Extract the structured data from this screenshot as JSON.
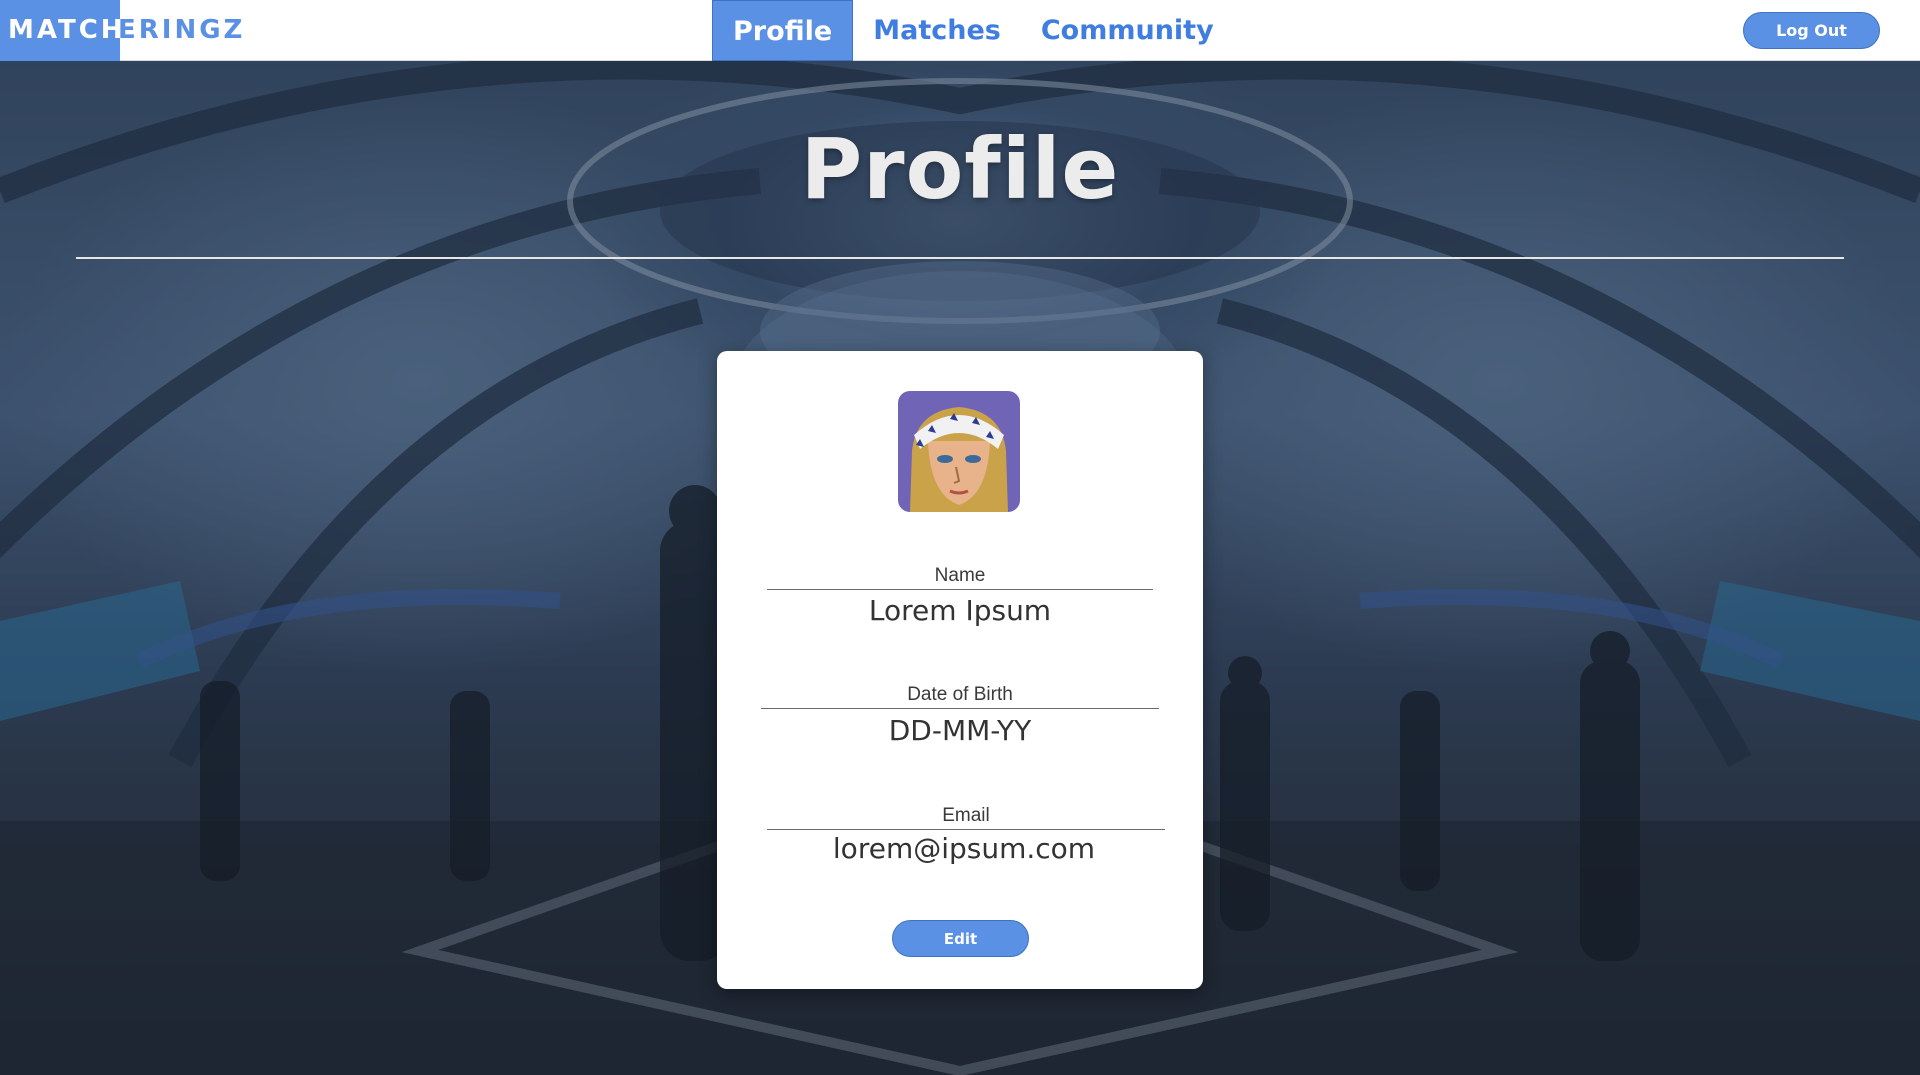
{
  "brand": {
    "name_highlight": "MATCH",
    "name_rest": "ERINGZ",
    "accent_color": "#5b91e4"
  },
  "nav": {
    "tabs": [
      {
        "label": "Profile",
        "active": true
      },
      {
        "label": "Matches",
        "active": false
      },
      {
        "label": "Community",
        "active": false
      }
    ],
    "logout_label": "Log Out"
  },
  "page": {
    "title": "Profile"
  },
  "profile": {
    "avatar_icon": "character-portrait",
    "fields": [
      {
        "label": "Name",
        "value": "Lorem Ipsum"
      },
      {
        "label": "Date of Birth",
        "value": "DD-MM-YY"
      },
      {
        "label": "Email",
        "value": "lorem@ipsum.com"
      }
    ],
    "edit_label": "Edit"
  }
}
